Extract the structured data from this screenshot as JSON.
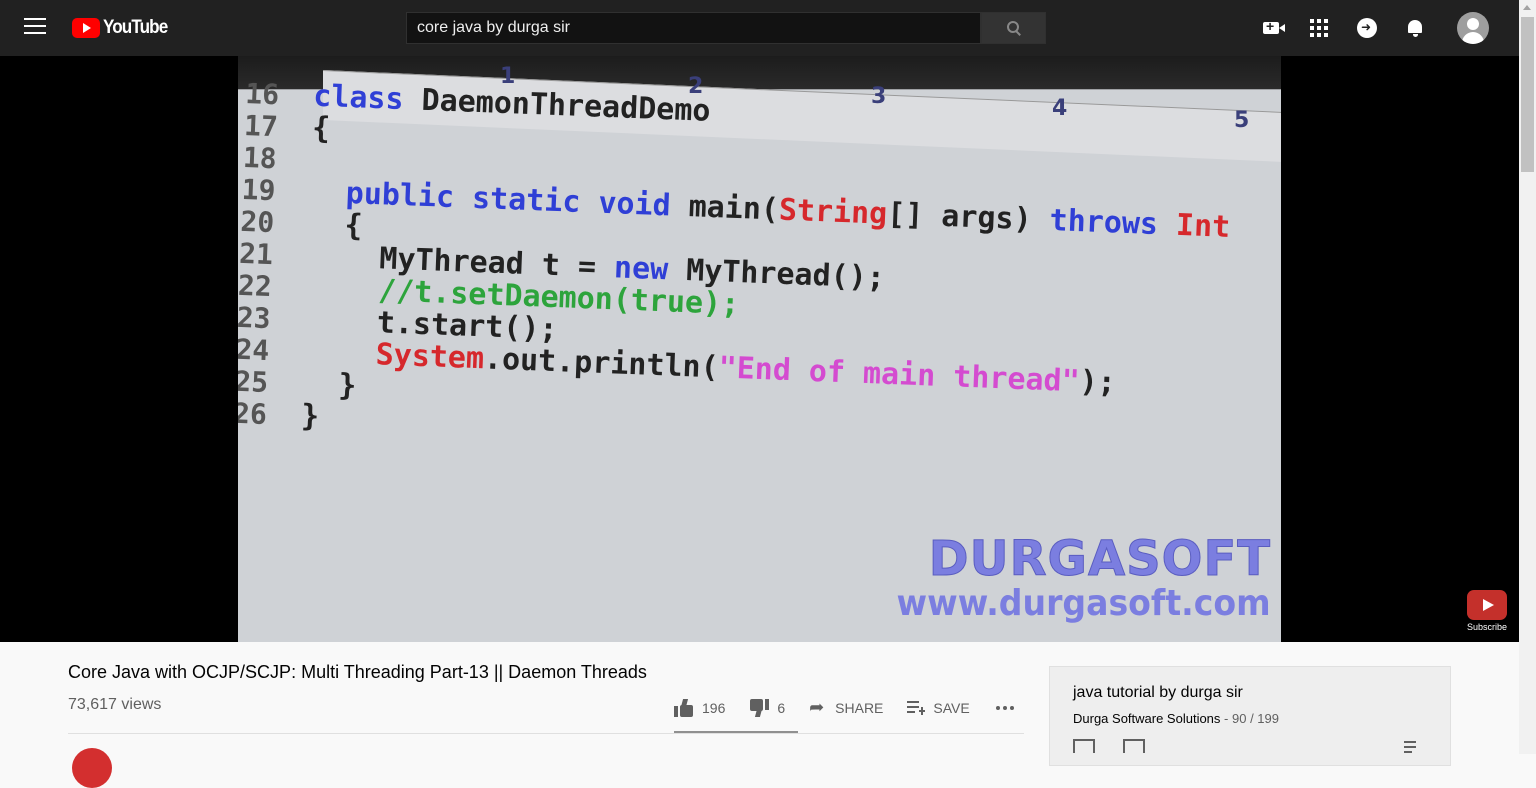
{
  "header": {
    "logo_text": "YouTube",
    "search_value": "core java by durga sir",
    "icons": [
      "menu-icon",
      "search-icon",
      "create-video-icon",
      "apps-icon",
      "messages-icon",
      "notifications-icon",
      "account-avatar"
    ]
  },
  "video": {
    "ruler_numbers": [
      "1",
      "2",
      "3",
      "4",
      "5"
    ],
    "code_lines": [
      {
        "n": "16",
        "parts": [
          {
            "t": "class ",
            "c": "kw"
          },
          {
            "t": "DaemonThreadDemo",
            "c": ""
          }
        ]
      },
      {
        "n": "17",
        "parts": [
          {
            "t": "{",
            "c": ""
          }
        ]
      },
      {
        "n": "18",
        "parts": []
      },
      {
        "n": "19",
        "parts": [
          {
            "t": "  public static void ",
            "c": "kw"
          },
          {
            "t": "main(",
            "c": ""
          },
          {
            "t": "String",
            "c": "red"
          },
          {
            "t": "[] args) ",
            "c": ""
          },
          {
            "t": "throws ",
            "c": "kw"
          },
          {
            "t": "Int",
            "c": "red"
          }
        ]
      },
      {
        "n": "20",
        "parts": [
          {
            "t": "  {",
            "c": ""
          }
        ]
      },
      {
        "n": "21",
        "parts": [
          {
            "t": "    MyThread t = ",
            "c": ""
          },
          {
            "t": "new ",
            "c": "kw"
          },
          {
            "t": "MyThread();",
            "c": ""
          }
        ]
      },
      {
        "n": "22",
        "parts": [
          {
            "t": "    //t.setDaemon(true);",
            "c": "green"
          }
        ]
      },
      {
        "n": "23",
        "parts": [
          {
            "t": "    t.start();",
            "c": ""
          }
        ]
      },
      {
        "n": "24",
        "parts": [
          {
            "t": "    System",
            "c": "red"
          },
          {
            "t": ".out.println(",
            "c": ""
          },
          {
            "t": "\"End of main thread\"",
            "c": "pink"
          },
          {
            "t": ");",
            "c": ""
          }
        ]
      },
      {
        "n": "25",
        "parts": [
          {
            "t": "  }",
            "c": ""
          }
        ]
      },
      {
        "n": "26",
        "parts": [
          {
            "t": "}",
            "c": ""
          }
        ]
      }
    ],
    "watermark_line1": "DURGASOFT",
    "watermark_line2": "www.durgasoft.com",
    "subscribe_label": "Subscribe"
  },
  "info": {
    "title": "Core Java with OCJP/SCJP: Multi Threading Part-13 || Daemon Threads",
    "views": "73,617 views",
    "likes": "196",
    "dislikes": "6",
    "share_label": "SHARE",
    "save_label": "SAVE",
    "like_ratio": 0.97
  },
  "playlist": {
    "title": "java tutorial by durga sir",
    "channel": "Durga Software Solutions",
    "position": "90 / 199"
  },
  "colors": {
    "header_bg": "#212121",
    "player_bg": "#000000",
    "logo_red": "#ff0000",
    "keyword_blue": "#2f3fd6",
    "type_red": "#d6282c",
    "comment_green": "#2da43c",
    "string_pink": "#d44bd0",
    "watermark": "#7b7ee0"
  }
}
